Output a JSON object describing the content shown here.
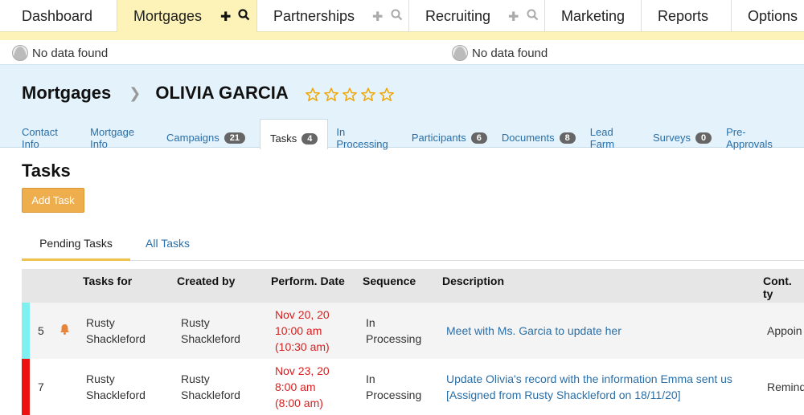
{
  "nav": {
    "dashboard": "Dashboard",
    "mortgages": "Mortgages",
    "partnerships": "Partnerships",
    "recruiting": "Recruiting",
    "marketing": "Marketing",
    "reports": "Reports",
    "options": "Options"
  },
  "no_data_left": "No data found",
  "no_data_right": "No data found",
  "header": {
    "section": "Mortgages",
    "contact_name": "OLIVIA GARCIA",
    "rating": 0,
    "rating_max": 5
  },
  "tabs": [
    {
      "label": "Contact Info",
      "count": ""
    },
    {
      "label": "Mortgage Info",
      "count": ""
    },
    {
      "label": "Campaigns",
      "count": "21"
    },
    {
      "label": "Tasks",
      "count": "4"
    },
    {
      "label": "In Processing",
      "count": ""
    },
    {
      "label": "Participants",
      "count": "6"
    },
    {
      "label": "Documents",
      "count": "8"
    },
    {
      "label": "Lead Farm",
      "count": ""
    },
    {
      "label": "Surveys",
      "count": "0"
    },
    {
      "label": "Pre-Approvals",
      "count": ""
    }
  ],
  "page": {
    "title": "Tasks",
    "add_task": "Add Task",
    "subtab_pending": "Pending Tasks",
    "subtab_all": "All Tasks"
  },
  "table": {
    "columns": {
      "tasks_for": "Tasks for",
      "created_by": "Created by",
      "perform_date": "Perform. Date",
      "sequence": "Sequence",
      "description": "Description",
      "cont_type": "Cont. ty"
    },
    "rows": [
      {
        "id": "5",
        "color": "#7ff0f0",
        "tasks_for_1": "Rusty",
        "tasks_for_2": "Shackleford",
        "created_by_1": "Rusty",
        "created_by_2": "Shackleford",
        "date_1": "Nov 20, 20",
        "date_2": "10:00 am",
        "date_3": "(10:30 am)",
        "seq_1": "In",
        "seq_2": "Processing",
        "desc_1": "Meet with Ms. Garcia to update her",
        "desc_2": "",
        "type": "Appoin"
      },
      {
        "id": "7",
        "color": "#ee1111",
        "tasks_for_1": "Rusty",
        "tasks_for_2": "Shackleford",
        "created_by_1": "Rusty",
        "created_by_2": "Shackleford",
        "date_1": "Nov 23, 20",
        "date_2": "8:00 am",
        "date_3": "(8:00 am)",
        "seq_1": "In",
        "seq_2": "Processing",
        "desc_1": "Update Olivia's record with the information Emma sent us",
        "desc_2": "[Assigned from Rusty Shackleford on 18/11/20]",
        "type": "Remind"
      }
    ]
  },
  "colors": {
    "accent_yellow": "#fdf2b8",
    "header_blue": "#e3f2fb",
    "link": "#2a6fa8",
    "button": "#efae4e",
    "date_red": "#d62020"
  }
}
